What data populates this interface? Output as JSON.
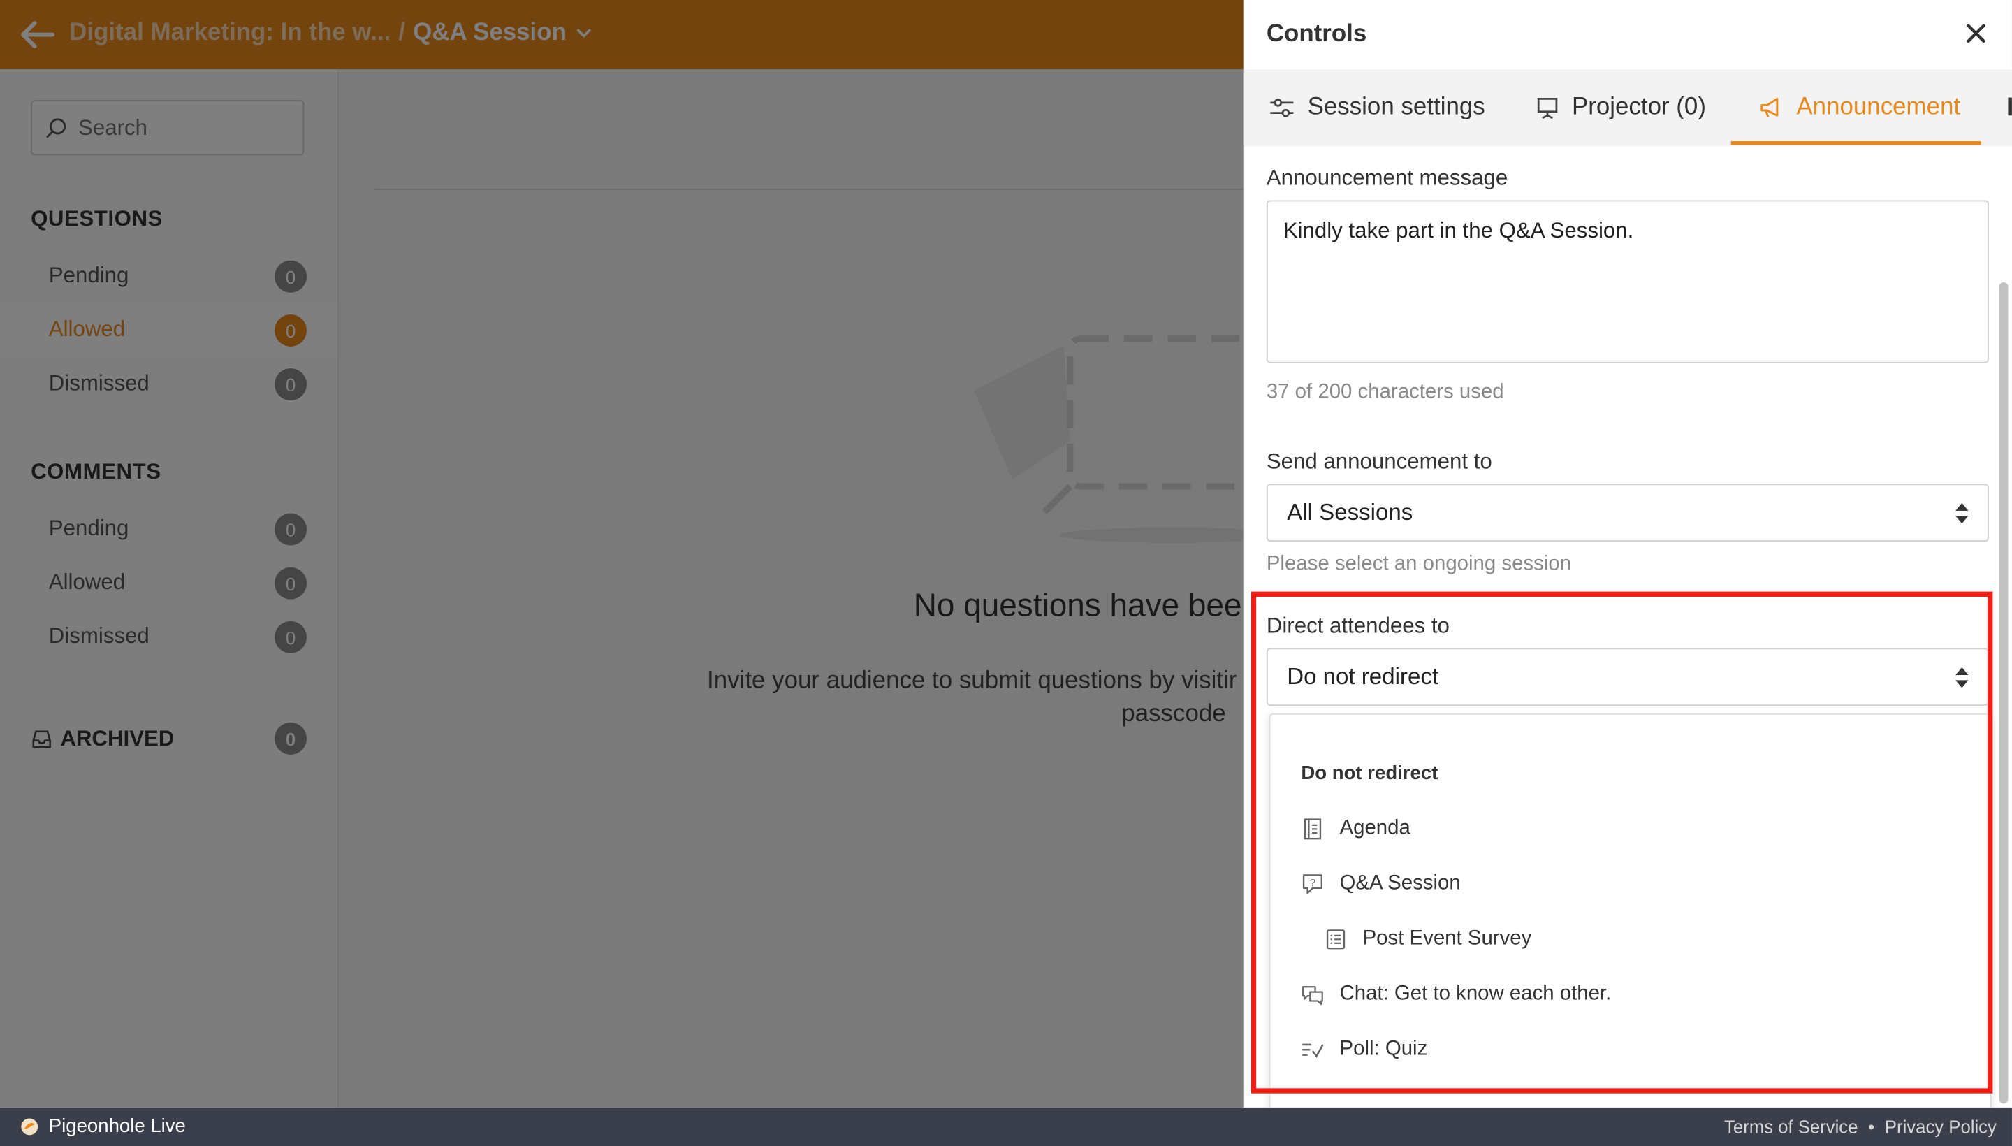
{
  "header": {
    "event_title": "Digital Marketing: In the w...",
    "separator": "/",
    "session_title": "Q&A Session"
  },
  "sidebar": {
    "search_placeholder": "Search",
    "questions_title": "QUESTIONS",
    "questions": [
      {
        "label": "Pending",
        "count": "0"
      },
      {
        "label": "Allowed",
        "count": "0"
      },
      {
        "label": "Dismissed",
        "count": "0"
      }
    ],
    "comments_title": "COMMENTS",
    "comments": [
      {
        "label": "Pending",
        "count": "0"
      },
      {
        "label": "Allowed",
        "count": "0"
      },
      {
        "label": "Dismissed",
        "count": "0"
      }
    ],
    "archived_label": "ARCHIVED",
    "archived_count": "0"
  },
  "main": {
    "empty_title": "No questions have been",
    "empty_sub_line1": "Invite your audience to submit questions by visitir",
    "empty_sub_line2": "passcode"
  },
  "panel": {
    "title": "Controls",
    "tabs": [
      {
        "label": "Session settings"
      },
      {
        "label": "Projector (0)"
      },
      {
        "label": "Announcement"
      }
    ],
    "announcement_label": "Announcement message",
    "announcement_value": "Kindly take part in the Q&A Session.",
    "char_count": "37 of 200 characters used",
    "send_to_label": "Send announcement to",
    "send_to_value": "All Sessions",
    "send_to_hint": "Please select an ongoing session",
    "direct_label": "Direct attendees to",
    "direct_value": "Do not redirect",
    "options": [
      {
        "label": "Do not redirect",
        "icon": "none"
      },
      {
        "label": "Agenda",
        "icon": "agenda-icon"
      },
      {
        "label": "Q&A Session",
        "icon": "question-bubble-icon"
      },
      {
        "label": "Post Event Survey",
        "icon": "survey-icon"
      },
      {
        "label": "Chat: Get to know each other.",
        "icon": "chat-icon"
      },
      {
        "label": "Poll: Quiz",
        "icon": "poll-icon"
      }
    ]
  },
  "footer": {
    "brand": "Pigeonhole Live",
    "terms": "Terms of Service",
    "dot": "•",
    "privacy": "Privacy Policy"
  },
  "colors": {
    "brand_orange": "#e8891c",
    "highlight_red": "#f21d14",
    "footer_bg": "#3b3f4c"
  }
}
